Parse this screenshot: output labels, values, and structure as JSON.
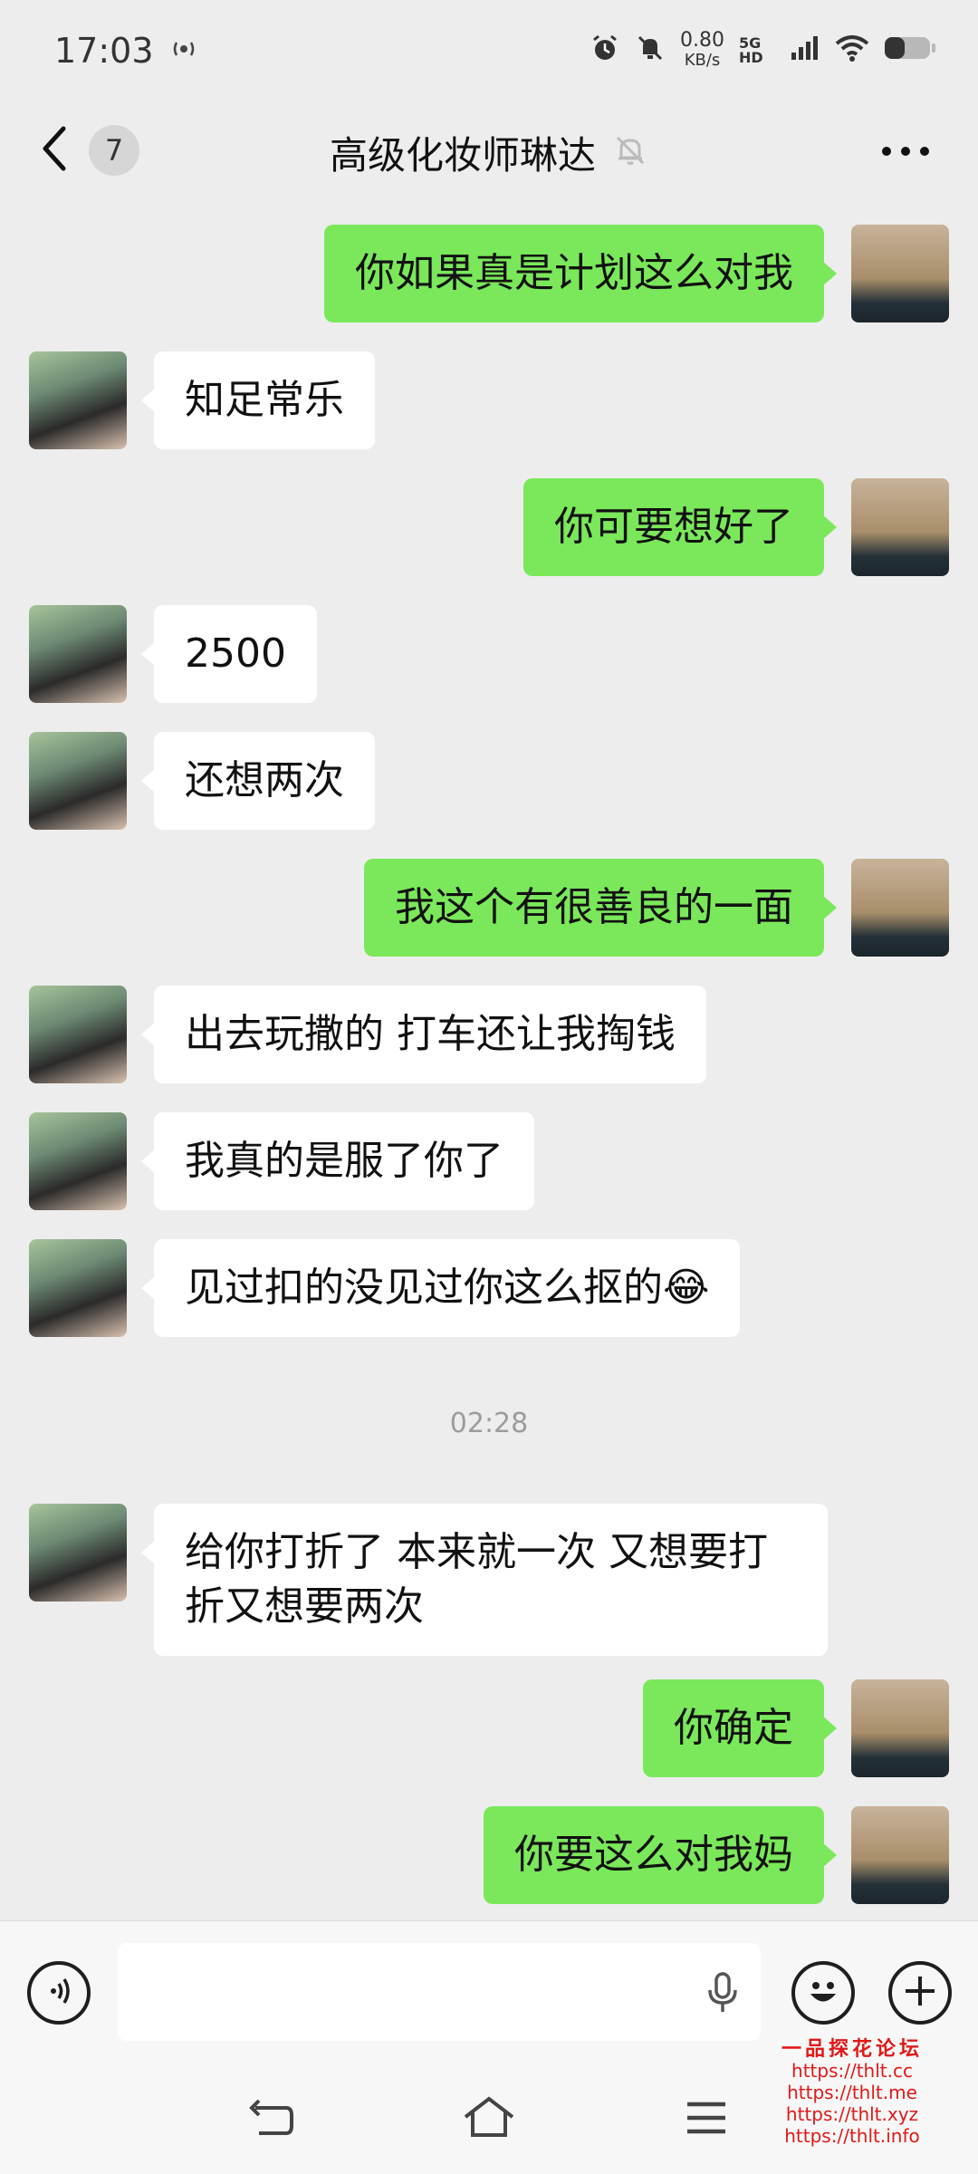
{
  "status_bar": {
    "time": "17:03",
    "net_speed": "0.80",
    "net_unit": "KB/s",
    "network": "5G HD",
    "icons": [
      "alarm-icon",
      "mute-icon",
      "signal-icon",
      "wifi-icon",
      "battery-icon"
    ]
  },
  "header": {
    "unread_count": "7",
    "title": "高级化妆师琳达",
    "icons": [
      "back-chevron-icon",
      "muted-bell-icon",
      "more-dots-icon"
    ]
  },
  "messages": [
    {
      "side": "right",
      "text": "你如果真是计划这么对我"
    },
    {
      "side": "left",
      "text": "知足常乐"
    },
    {
      "side": "right",
      "text": "你可要想好了"
    },
    {
      "side": "left",
      "text": "2500"
    },
    {
      "side": "left",
      "text": "还想两次"
    },
    {
      "side": "right",
      "text": "我这个有很善良的一面"
    },
    {
      "side": "left",
      "text": "出去玩撒的 打车还让我掏钱"
    },
    {
      "side": "left",
      "text": "我真的是服了你了"
    },
    {
      "side": "left",
      "text": "见过扣的没见过你这么抠的😂"
    },
    {
      "side": "left",
      "text": "给你打折了 本来就一次 又想要打折又想要两次"
    },
    {
      "side": "right",
      "text": "你确定"
    },
    {
      "side": "right",
      "text": "你要这么对我妈"
    }
  ],
  "timestamp": "02:28",
  "input_bar": {
    "icons": [
      "voice-icon",
      "mic-icon",
      "emoji-icon",
      "plus-icon"
    ]
  },
  "nav_bar": {
    "icons": [
      "nav-back-icon",
      "nav-home-icon",
      "nav-menu-icon"
    ]
  },
  "watermark": {
    "title": "一品探花论坛",
    "lines": [
      "https://thlt.cc",
      "https://thlt.me",
      "https://thlt.xyz",
      "https://thlt.info"
    ]
  },
  "colors": {
    "sent_bubble": "#7ae85a",
    "received_bubble": "#ffffff",
    "background": "#ededed",
    "watermark": "#e01818"
  }
}
